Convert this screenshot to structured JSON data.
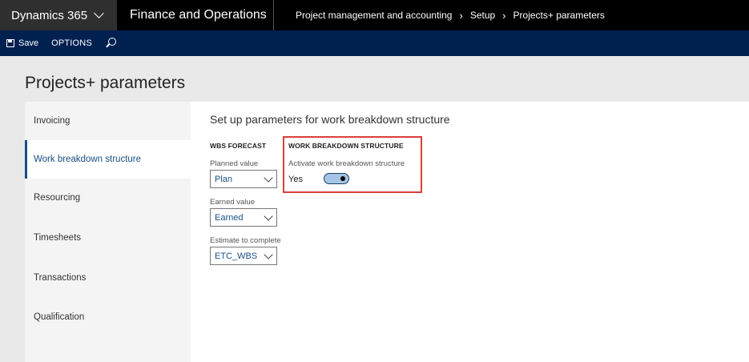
{
  "topbar": {
    "brand": "Dynamics 365",
    "app_name": "Finance and Operations",
    "breadcrumbs": [
      "Project management and accounting",
      "Setup",
      "Projects+ parameters"
    ]
  },
  "actionbar": {
    "save_label": "Save",
    "options_label": "OPTIONS"
  },
  "page": {
    "title": "Projects+ parameters"
  },
  "sidebar": {
    "items": [
      {
        "label": "Invoicing",
        "active": false
      },
      {
        "label": "Work breakdown structure",
        "active": true
      },
      {
        "label": "Resourcing",
        "active": false
      },
      {
        "label": "Timesheets",
        "active": false
      },
      {
        "label": "Transactions",
        "active": false
      },
      {
        "label": "Qualification",
        "active": false
      }
    ]
  },
  "content": {
    "section_title": "Set up parameters for work breakdown structure",
    "wbs_forecast": {
      "heading": "WBS FORECAST",
      "planned_value_label": "Planned value",
      "planned_value": "Plan",
      "earned_value_label": "Earned value",
      "earned_value": "Earned",
      "estimate_label": "Estimate to complete",
      "estimate_value": "ETC_WBS"
    },
    "wbs": {
      "heading": "WORK BREAKDOWN STRUCTURE",
      "activate_label": "Activate work breakdown structure",
      "toggle_text": "Yes",
      "toggle_on": true
    }
  },
  "colors": {
    "accent": "#1a4f86",
    "actionbar": "#002050",
    "highlight": "#d9403b"
  }
}
